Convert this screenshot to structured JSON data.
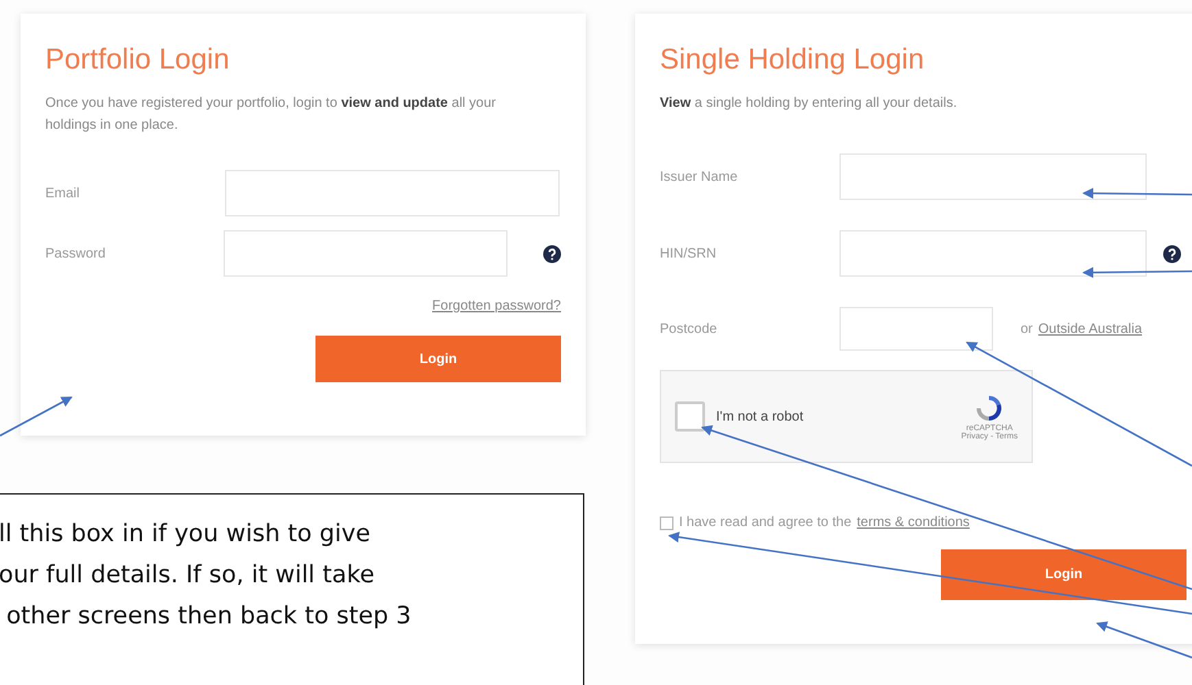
{
  "portfolio_login": {
    "title": "Portfolio Login",
    "description": "Once you have registered your portfolio, login to **view and update** all your holdings in one place.",
    "fields": [
      {
        "label": "Email",
        "kind": "full",
        "help": false
      },
      {
        "label": "Password",
        "kind": "password",
        "help": true
      }
    ],
    "forgot_link": "Forgotten password?",
    "button": "Login"
  },
  "single_holding_login": {
    "title": "Single Holding Login",
    "description": "**View** a single holding by entering all your details.",
    "fields": [
      {
        "label": "Issuer Name",
        "kind": "full",
        "help": false
      },
      {
        "label": "HIN/SRN",
        "kind": "full",
        "help": true
      },
      {
        "label": "Postcode",
        "kind": "short",
        "help": false,
        "alt_text": "or",
        "alt_link": "Outside Australia"
      }
    ],
    "recaptcha": {
      "label": "I'm not a robot",
      "checked": false,
      "brand": "reCAPTCHA",
      "links": "Privacy - Terms"
    },
    "terms": {
      "text": "I have read and agree to the",
      "link": "terms & conditions",
      "checked": false
    },
    "button": "Login"
  },
  "callout": {
    "lines": [
      "ll this box in if you wish to give",
      "our full details. If so, it will take",
      " other screens then back to step 3"
    ]
  }
}
